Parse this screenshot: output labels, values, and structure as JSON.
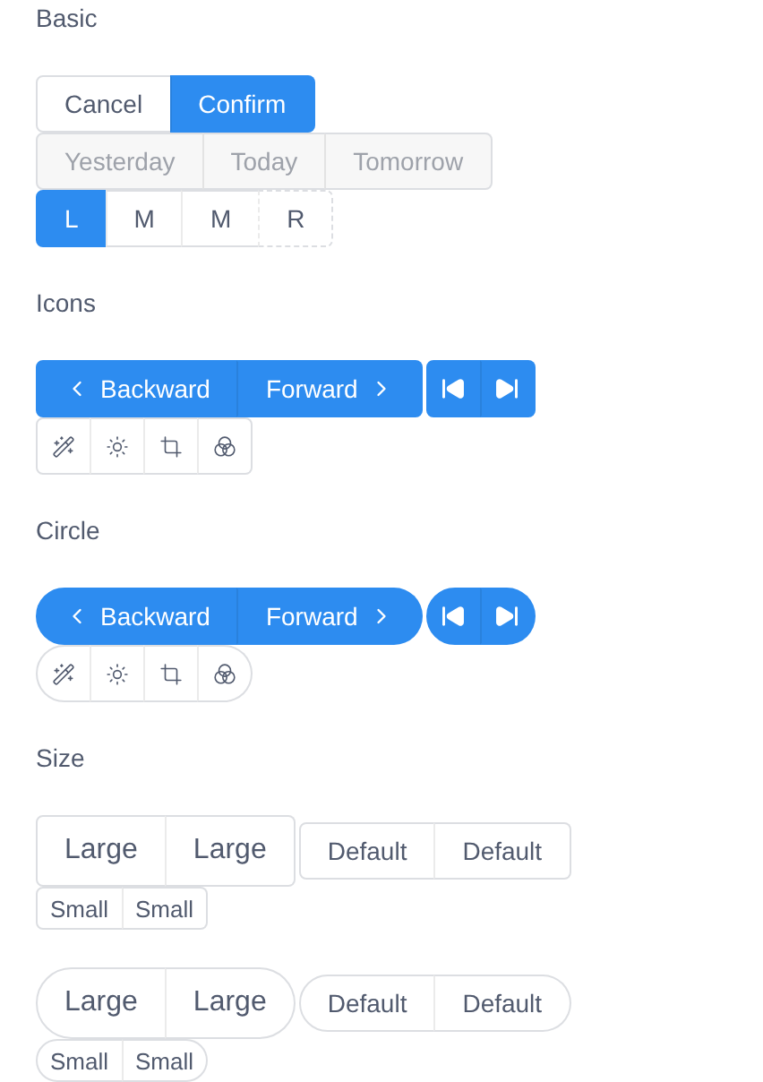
{
  "sections": [
    {
      "title": "Basic",
      "groups": [
        {
          "kind": "text",
          "round": false,
          "large": false,
          "small": false,
          "buttons": [
            {
              "label": "Cancel",
              "primary": false,
              "dashed": false,
              "disabled": false,
              "kind": "plain"
            },
            {
              "label": "Confirm",
              "primary": true,
              "dashed": false,
              "disabled": false,
              "kind": "plain"
            }
          ]
        },
        {
          "kind": "text",
          "round": false,
          "large": false,
          "small": false,
          "buttons": [
            {
              "label": "Yesterday",
              "primary": false,
              "dashed": false,
              "disabled": true,
              "kind": "plain"
            },
            {
              "label": "Today",
              "primary": false,
              "dashed": false,
              "disabled": true,
              "kind": "plain"
            },
            {
              "label": "Tomorrow",
              "primary": false,
              "dashed": false,
              "disabled": true,
              "kind": "plain"
            }
          ]
        },
        {
          "kind": "text",
          "round": false,
          "large": false,
          "small": false,
          "buttons": [
            {
              "label": "L",
              "primary": true,
              "dashed": false,
              "disabled": false,
              "kind": "plain"
            },
            {
              "label": "M",
              "primary": false,
              "dashed": false,
              "disabled": false,
              "kind": "plain"
            },
            {
              "label": "M",
              "primary": false,
              "dashed": false,
              "disabled": false,
              "kind": "plain"
            },
            {
              "label": "R",
              "primary": false,
              "dashed": true,
              "disabled": false,
              "kind": "plain"
            }
          ]
        }
      ]
    },
    {
      "title": "Icons",
      "groups": [
        {
          "kind": "text",
          "round": false,
          "large": false,
          "small": false,
          "buttons": [
            {
              "label": "Backward",
              "primary": true,
              "dashed": false,
              "disabled": false,
              "kind": "back"
            },
            {
              "label": "Forward",
              "primary": true,
              "dashed": false,
              "disabled": false,
              "kind": "forward"
            }
          ]
        },
        {
          "kind": "media",
          "round": false,
          "large": false,
          "small": false,
          "buttons": [
            {
              "primary": true,
              "dashed": false,
              "disabled": false,
              "kind": "icon"
            },
            {
              "primary": true,
              "dashed": false,
              "disabled": false,
              "kind": "icon"
            }
          ]
        },
        {
          "kind": "tools",
          "round": false,
          "large": false,
          "small": false,
          "buttons": [
            {
              "primary": false,
              "dashed": false,
              "disabled": false,
              "kind": "icon"
            },
            {
              "primary": false,
              "dashed": false,
              "disabled": false,
              "kind": "icon"
            },
            {
              "primary": false,
              "dashed": false,
              "disabled": false,
              "kind": "icon"
            },
            {
              "primary": false,
              "dashed": false,
              "disabled": false,
              "kind": "icon"
            }
          ]
        }
      ]
    },
    {
      "title": "Circle",
      "groups": [
        {
          "kind": "text",
          "round": true,
          "large": false,
          "small": false,
          "buttons": [
            {
              "label": "Backward",
              "primary": true,
              "dashed": false,
              "disabled": false,
              "kind": "back"
            },
            {
              "label": "Forward",
              "primary": true,
              "dashed": false,
              "disabled": false,
              "kind": "forward"
            }
          ]
        },
        {
          "kind": "media",
          "round": true,
          "large": false,
          "small": false,
          "buttons": [
            {
              "primary": true,
              "dashed": false,
              "disabled": false,
              "kind": "icon"
            },
            {
              "primary": true,
              "dashed": false,
              "disabled": false,
              "kind": "icon"
            }
          ]
        },
        {
          "kind": "tools",
          "round": true,
          "large": false,
          "small": false,
          "buttons": [
            {
              "primary": false,
              "dashed": false,
              "disabled": false,
              "kind": "icon"
            },
            {
              "primary": false,
              "dashed": false,
              "disabled": false,
              "kind": "icon"
            },
            {
              "primary": false,
              "dashed": false,
              "disabled": false,
              "kind": "icon"
            },
            {
              "primary": false,
              "dashed": false,
              "disabled": false,
              "kind": "icon"
            }
          ]
        }
      ]
    },
    {
      "title": "Size",
      "groups": [
        {
          "kind": "text",
          "round": false,
          "large": true,
          "small": false,
          "buttons": [
            {
              "label": "Large",
              "primary": false,
              "dashed": false,
              "disabled": false,
              "kind": "plain"
            },
            {
              "label": "Large",
              "primary": false,
              "dashed": false,
              "disabled": false,
              "kind": "plain"
            }
          ]
        },
        {
          "kind": "text",
          "round": false,
          "large": false,
          "small": false,
          "buttons": [
            {
              "label": "Default",
              "primary": false,
              "dashed": false,
              "disabled": false,
              "kind": "plain"
            },
            {
              "label": "Default",
              "primary": false,
              "dashed": false,
              "disabled": false,
              "kind": "plain"
            }
          ]
        },
        {
          "kind": "text",
          "round": false,
          "large": false,
          "small": true,
          "buttons": [
            {
              "label": "Small",
              "primary": false,
              "dashed": false,
              "disabled": false,
              "kind": "plain"
            },
            {
              "label": "Small",
              "primary": false,
              "dashed": false,
              "disabled": false,
              "kind": "plain"
            }
          ]
        },
        {
          "kind": "break"
        },
        {
          "kind": "text",
          "round": true,
          "large": true,
          "small": false,
          "buttons": [
            {
              "label": "Large",
              "primary": false,
              "dashed": false,
              "disabled": false,
              "kind": "plain"
            },
            {
              "label": "Large",
              "primary": false,
              "dashed": false,
              "disabled": false,
              "kind": "plain"
            }
          ]
        },
        {
          "kind": "text",
          "round": true,
          "large": false,
          "small": false,
          "buttons": [
            {
              "label": "Default",
              "primary": false,
              "dashed": false,
              "disabled": false,
              "kind": "plain"
            },
            {
              "label": "Default",
              "primary": false,
              "dashed": false,
              "disabled": false,
              "kind": "plain"
            }
          ]
        },
        {
          "kind": "text",
          "round": true,
          "large": false,
          "small": true,
          "buttons": [
            {
              "label": "Small",
              "primary": false,
              "dashed": false,
              "disabled": false,
              "kind": "plain"
            },
            {
              "label": "Small",
              "primary": false,
              "dashed": false,
              "disabled": false,
              "kind": "plain"
            }
          ]
        }
      ]
    }
  ]
}
